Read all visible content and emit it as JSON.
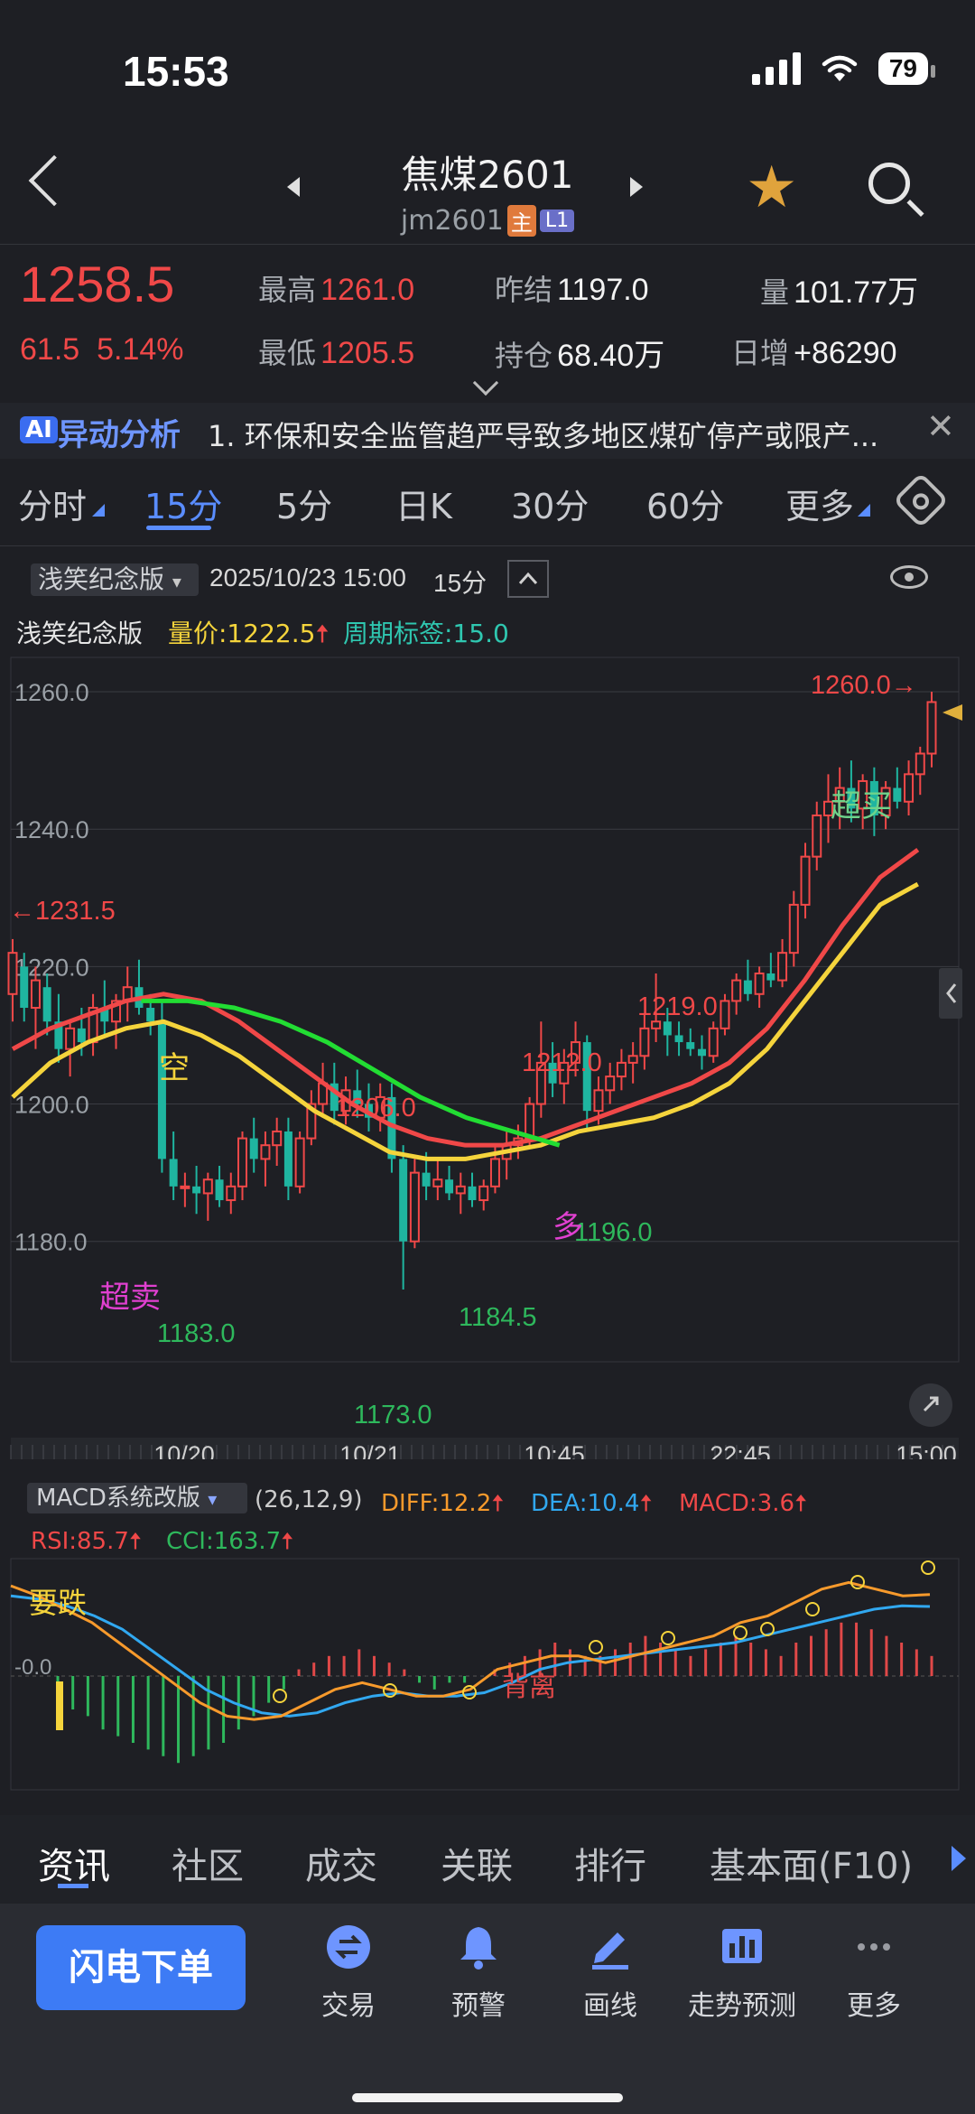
{
  "status": {
    "time": "15:53",
    "battery": "79"
  },
  "header": {
    "title": "焦煤2601",
    "code": "jm2601",
    "tag_main": "主",
    "tag_level": "L1"
  },
  "quote": {
    "price": "1258.5",
    "change": "61.5",
    "change_pct": "5.14%",
    "high_label": "最高",
    "high": "1261.0",
    "low_label": "最低",
    "low": "1205.5",
    "prev_settle_label": "昨结",
    "prev_settle": "1197.0",
    "open_int_label": "持仓",
    "open_int": "68.40万",
    "volume_label": "量",
    "volume": "101.77万",
    "daily_inc_label": "日增",
    "daily_inc": "+86290"
  },
  "ai": {
    "badge": "AI",
    "title": "异动分析",
    "text": "1. 环保和安全监管趋严导致多地区煤矿停产或限产..."
  },
  "period_tabs": [
    "分时",
    "15分",
    "5分",
    "日K",
    "30分",
    "60分",
    "更多"
  ],
  "chart_toolbar": {
    "indicator": "浅笑纪念版",
    "datetime": "2025/10/23 15:00",
    "period": "15分"
  },
  "legend": {
    "name": "浅笑纪念版",
    "vol_price": "量价:1222.5",
    "cycle_tag": "周期标签:15.0"
  },
  "chart_data": [
    {
      "type": "candlestick",
      "title": "",
      "ylim": [
        1168,
        1265
      ],
      "y_ticks": [
        "1260.0",
        "1240.0",
        "1220.0",
        "1200.0",
        "1180.0"
      ],
      "x_ticks": [
        "10/20",
        "10/21",
        "10:45",
        "22:45",
        "15:00"
      ],
      "candles": [
        {
          "o": 1216,
          "h": 1224,
          "l": 1212,
          "c": 1222
        },
        {
          "o": 1220,
          "h": 1222,
          "l": 1212,
          "c": 1214
        },
        {
          "o": 1214,
          "h": 1220,
          "l": 1208,
          "c": 1218
        },
        {
          "o": 1217,
          "h": 1219,
          "l": 1210,
          "c": 1212
        },
        {
          "o": 1212,
          "h": 1216,
          "l": 1206,
          "c": 1208
        },
        {
          "o": 1208,
          "h": 1212,
          "l": 1204,
          "c": 1211
        },
        {
          "o": 1211,
          "h": 1214,
          "l": 1207,
          "c": 1209
        },
        {
          "o": 1209,
          "h": 1216,
          "l": 1207,
          "c": 1214
        },
        {
          "o": 1214,
          "h": 1218,
          "l": 1210,
          "c": 1212
        },
        {
          "o": 1212,
          "h": 1216,
          "l": 1208,
          "c": 1215
        },
        {
          "o": 1215,
          "h": 1220,
          "l": 1212,
          "c": 1217
        },
        {
          "o": 1217,
          "h": 1221,
          "l": 1213,
          "c": 1214
        },
        {
          "o": 1214,
          "h": 1216,
          "l": 1210,
          "c": 1212
        },
        {
          "o": 1212,
          "h": 1215,
          "l": 1190,
          "c": 1192
        },
        {
          "o": 1192,
          "h": 1196,
          "l": 1186,
          "c": 1188
        },
        {
          "o": 1188,
          "h": 1190,
          "l": 1185,
          "c": 1188
        },
        {
          "o": 1188,
          "h": 1191,
          "l": 1184,
          "c": 1187
        },
        {
          "o": 1187,
          "h": 1190,
          "l": 1183,
          "c": 1189
        },
        {
          "o": 1189,
          "h": 1191,
          "l": 1185,
          "c": 1186
        },
        {
          "o": 1186,
          "h": 1190,
          "l": 1184,
          "c": 1188
        },
        {
          "o": 1188,
          "h": 1196,
          "l": 1186,
          "c": 1195
        },
        {
          "o": 1195,
          "h": 1198,
          "l": 1190,
          "c": 1192
        },
        {
          "o": 1192,
          "h": 1196,
          "l": 1188,
          "c": 1194
        },
        {
          "o": 1194,
          "h": 1198,
          "l": 1191,
          "c": 1196
        },
        {
          "o": 1196,
          "h": 1198,
          "l": 1186,
          "c": 1188
        },
        {
          "o": 1188,
          "h": 1196,
          "l": 1187,
          "c": 1195
        },
        {
          "o": 1195,
          "h": 1202,
          "l": 1194,
          "c": 1200
        },
        {
          "o": 1200,
          "h": 1206,
          "l": 1198,
          "c": 1203
        },
        {
          "o": 1203,
          "h": 1206,
          "l": 1197,
          "c": 1199
        },
        {
          "o": 1199,
          "h": 1204,
          "l": 1197,
          "c": 1202
        },
        {
          "o": 1202,
          "h": 1205,
          "l": 1198,
          "c": 1200
        },
        {
          "o": 1200,
          "h": 1203,
          "l": 1196,
          "c": 1198
        },
        {
          "o": 1198,
          "h": 1203,
          "l": 1196,
          "c": 1201
        },
        {
          "o": 1201,
          "h": 1203,
          "l": 1190,
          "c": 1192
        },
        {
          "o": 1192,
          "h": 1194,
          "l": 1173,
          "c": 1180
        },
        {
          "o": 1180,
          "h": 1192,
          "l": 1179,
          "c": 1190
        },
        {
          "o": 1190,
          "h": 1193,
          "l": 1186,
          "c": 1188
        },
        {
          "o": 1188,
          "h": 1192,
          "l": 1186,
          "c": 1189
        },
        {
          "o": 1189,
          "h": 1191,
          "l": 1186,
          "c": 1187
        },
        {
          "o": 1187,
          "h": 1190,
          "l": 1184,
          "c": 1188
        },
        {
          "o": 1188,
          "h": 1190,
          "l": 1185,
          "c": 1186
        },
        {
          "o": 1186,
          "h": 1189,
          "l": 1184.5,
          "c": 1188
        },
        {
          "o": 1188,
          "h": 1194,
          "l": 1187,
          "c": 1192
        },
        {
          "o": 1192,
          "h": 1196,
          "l": 1189,
          "c": 1194
        },
        {
          "o": 1194,
          "h": 1197,
          "l": 1192,
          "c": 1195
        },
        {
          "o": 1195,
          "h": 1201,
          "l": 1194,
          "c": 1200
        },
        {
          "o": 1200,
          "h": 1212,
          "l": 1198,
          "c": 1206
        },
        {
          "o": 1206,
          "h": 1209,
          "l": 1201,
          "c": 1203
        },
        {
          "o": 1203,
          "h": 1208,
          "l": 1200,
          "c": 1206
        },
        {
          "o": 1206,
          "h": 1212,
          "l": 1204,
          "c": 1209
        },
        {
          "o": 1209,
          "h": 1210,
          "l": 1196,
          "c": 1199
        },
        {
          "o": 1199,
          "h": 1204,
          "l": 1197,
          "c": 1202
        },
        {
          "o": 1202,
          "h": 1206,
          "l": 1200,
          "c": 1204
        },
        {
          "o": 1204,
          "h": 1208,
          "l": 1202,
          "c": 1206
        },
        {
          "o": 1206,
          "h": 1209,
          "l": 1203,
          "c": 1207
        },
        {
          "o": 1207,
          "h": 1213,
          "l": 1205,
          "c": 1211
        },
        {
          "o": 1211,
          "h": 1219,
          "l": 1209,
          "c": 1212
        },
        {
          "o": 1212,
          "h": 1214,
          "l": 1207,
          "c": 1210
        },
        {
          "o": 1210,
          "h": 1212,
          "l": 1207,
          "c": 1209
        },
        {
          "o": 1209,
          "h": 1211,
          "l": 1207,
          "c": 1208
        },
        {
          "o": 1208,
          "h": 1210,
          "l": 1205,
          "c": 1207
        },
        {
          "o": 1207,
          "h": 1212,
          "l": 1206,
          "c": 1211
        },
        {
          "o": 1211,
          "h": 1216,
          "l": 1210,
          "c": 1215
        },
        {
          "o": 1215,
          "h": 1219,
          "l": 1213,
          "c": 1218
        },
        {
          "o": 1218,
          "h": 1221,
          "l": 1215,
          "c": 1216
        },
        {
          "o": 1216,
          "h": 1220,
          "l": 1214,
          "c": 1219
        },
        {
          "o": 1219,
          "h": 1222,
          "l": 1217,
          "c": 1218
        },
        {
          "o": 1218,
          "h": 1224,
          "l": 1217,
          "c": 1222
        },
        {
          "o": 1222,
          "h": 1231,
          "l": 1220,
          "c": 1229
        },
        {
          "o": 1229,
          "h": 1238,
          "l": 1227,
          "c": 1236
        },
        {
          "o": 1236,
          "h": 1244,
          "l": 1234,
          "c": 1242
        },
        {
          "o": 1242,
          "h": 1248,
          "l": 1238,
          "c": 1244
        },
        {
          "o": 1244,
          "h": 1249,
          "l": 1240,
          "c": 1246
        },
        {
          "o": 1246,
          "h": 1250,
          "l": 1241,
          "c": 1243
        },
        {
          "o": 1243,
          "h": 1248,
          "l": 1240,
          "c": 1247
        },
        {
          "o": 1247,
          "h": 1249,
          "l": 1239,
          "c": 1242
        },
        {
          "o": 1242,
          "h": 1247,
          "l": 1240,
          "c": 1246
        },
        {
          "o": 1246,
          "h": 1249,
          "l": 1243,
          "c": 1244
        },
        {
          "o": 1244,
          "h": 1250,
          "l": 1242,
          "c": 1248
        },
        {
          "o": 1248,
          "h": 1252,
          "l": 1245,
          "c": 1251
        },
        {
          "o": 1251,
          "h": 1260,
          "l": 1249,
          "c": 1258.5
        }
      ],
      "ma_red": [
        1208,
        1211,
        1213,
        1215,
        1216,
        1215,
        1212,
        1208,
        1204,
        1200,
        1197,
        1195,
        1194,
        1194,
        1195,
        1197,
        1199,
        1201,
        1203,
        1206,
        1211,
        1218,
        1226,
        1233,
        1237
      ],
      "ma_yellow": [
        1201,
        1206,
        1209,
        1211,
        1212,
        1210,
        1207,
        1203,
        1199,
        1196,
        1193,
        1192,
        1192,
        1193,
        1194,
        1196,
        1197,
        1198,
        1200,
        1203,
        1208,
        1215,
        1222,
        1229,
        1232
      ],
      "ma_green": [
        1215,
        1215,
        1214,
        1212,
        1209,
        1205,
        1201,
        1198,
        1196,
        1194
      ],
      "annotations": [
        {
          "text": "1260.0→",
          "kind": "high"
        },
        {
          "text": "←1231.5",
          "kind": "open"
        },
        {
          "text": "1206.0",
          "kind": "high"
        },
        {
          "text": "1212.0",
          "kind": "high"
        },
        {
          "text": "1219.0",
          "kind": "high"
        },
        {
          "text": "1183.0",
          "kind": "low"
        },
        {
          "text": "1173.0",
          "kind": "low"
        },
        {
          "text": "1184.5",
          "kind": "low"
        },
        {
          "text": "1196.0",
          "kind": "low"
        },
        {
          "text": "空",
          "kind": "short"
        },
        {
          "text": "多",
          "kind": "long"
        },
        {
          "text": "超卖",
          "kind": "oversold"
        },
        {
          "text": "超买",
          "kind": "overbought"
        }
      ]
    },
    {
      "type": "bar",
      "title": "",
      "ylim": [
        -14,
        14
      ],
      "zero_label": "0.0",
      "macd_bars": [
        -3,
        -5,
        -6,
        -8,
        -9,
        -10,
        -11,
        -12,
        -13,
        -12,
        -11,
        -10,
        -8,
        -6,
        -4,
        -2,
        1,
        2,
        3,
        3,
        4,
        3,
        2,
        1,
        -1,
        -2,
        -1,
        -1,
        0,
        1,
        2,
        3,
        4,
        5,
        4,
        3,
        3,
        4,
        5,
        6,
        5,
        4,
        3,
        4,
        5,
        6,
        5,
        4,
        3,
        5,
        6,
        7,
        8,
        8,
        7,
        6,
        5,
        4,
        3
      ],
      "diff": [
        13.5,
        12,
        10,
        8,
        5,
        2,
        -1,
        -4,
        -6,
        -6.5,
        -6,
        -4,
        -2,
        -1,
        -2,
        -3,
        -3,
        -2,
        1,
        2,
        3,
        3,
        2,
        3,
        4,
        5,
        6,
        8,
        9,
        11,
        13,
        14,
        13,
        12,
        12.2
      ],
      "dea": [
        12,
        11.5,
        10.5,
        9,
        7,
        4,
        1,
        -2,
        -4,
        -5.5,
        -6,
        -5.5,
        -4,
        -3,
        -2.5,
        -3,
        -3,
        -2.5,
        -1,
        1,
        2,
        2.5,
        3,
        3.5,
        4,
        4.5,
        5,
        6,
        7,
        8,
        9,
        10,
        10.5,
        10.4
      ],
      "annotations": [
        {
          "text": "要跌",
          "kind": "sell"
        },
        {
          "text": "背离",
          "kind": "divergence"
        }
      ]
    }
  ],
  "macd_panel": {
    "indicator": "MACD系统改版",
    "params": "(26,12,9)",
    "diff": "DIFF:12.2",
    "dea": "DEA:10.4",
    "macd": "MACD:3.6",
    "rsi": "RSI:85.7",
    "cci": "CCI:163.7"
  },
  "bottom_tabs": [
    "资讯",
    "社区",
    "成交",
    "关联",
    "排行",
    "基本面(F10)"
  ],
  "bottom_nav": {
    "order_button": "闪电下单",
    "items": [
      "交易",
      "预警",
      "画线",
      "走势预测",
      "更多"
    ]
  },
  "colors": {
    "up": "#f04848",
    "down": "#1fb5a0",
    "accent": "#5a8dff",
    "ma_yellow": "#f5d43c",
    "ma_green": "#22dd33"
  }
}
